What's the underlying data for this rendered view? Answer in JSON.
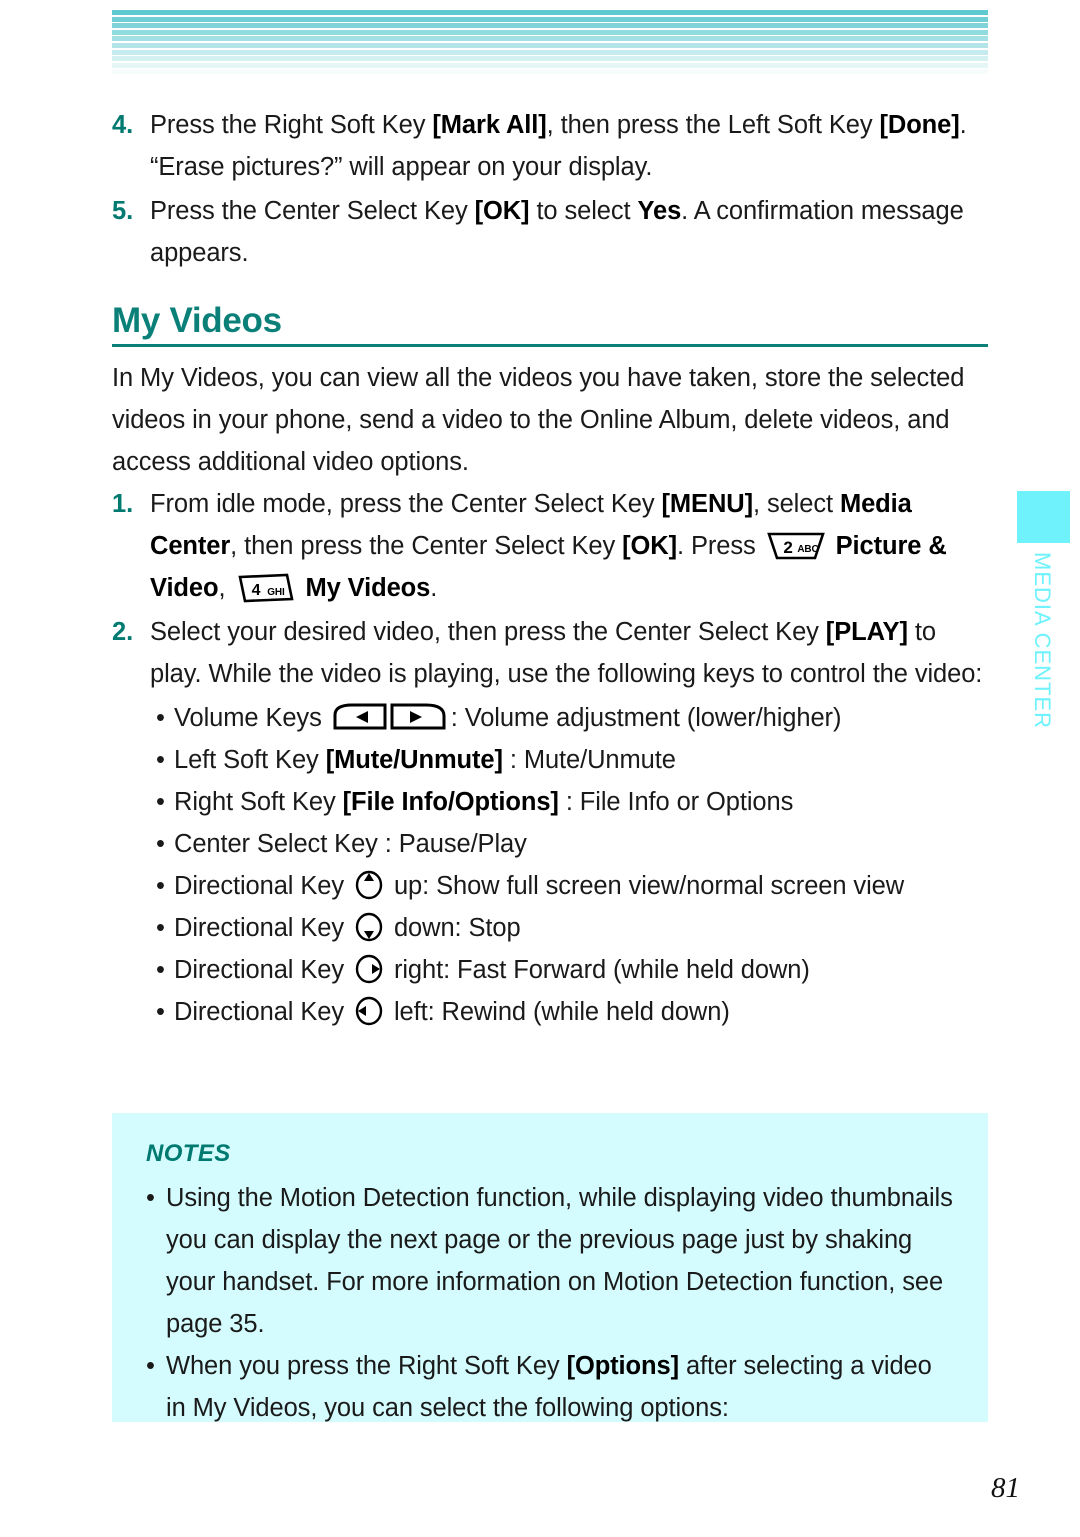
{
  "header": {
    "stripe_color_top": "#5ec9cf",
    "stripe_count": 11
  },
  "side_tab": {
    "label": "MEDIA CENTER",
    "color": "#6ff2fb"
  },
  "page_number": "81",
  "accent_color": "#007a70",
  "notes_bg": "#d4fbfd",
  "steps_top": [
    {
      "num": "4.",
      "parts": [
        {
          "t": "Press the Right Soft Key ",
          "b": false
        },
        {
          "t": "[Mark All]",
          "b": true
        },
        {
          "t": ", then press the Left Soft Key ",
          "b": false
        },
        {
          "t": "[Done]",
          "b": true
        },
        {
          "t": ". “Erase pictures?” will appear on your display.",
          "b": false
        }
      ]
    },
    {
      "num": "5.",
      "parts": [
        {
          "t": "Press the Center Select Key ",
          "b": false
        },
        {
          "t": "[OK]",
          "b": true
        },
        {
          "t": " to select ",
          "b": false
        },
        {
          "t": "Yes",
          "b": true
        },
        {
          "t": ". A confirmation message appears.",
          "b": false
        }
      ]
    }
  ],
  "section": {
    "title": "My Videos",
    "intro": "In My Videos, you can view all the videos you have taken, store the selected videos in your phone, send a video to the Online Album, delete videos, and access additional video options."
  },
  "steps_main": [
    {
      "num": "1.",
      "parts": [
        {
          "t": "From idle mode, press the Center Select Key ",
          "b": false
        },
        {
          "t": "[MENU]",
          "b": true
        },
        {
          "t": ", select ",
          "b": false
        },
        {
          "t": "Media Center",
          "b": true
        },
        {
          "t": ", then press the Center Select Key ",
          "b": false
        },
        {
          "t": "[OK]",
          "b": true
        },
        {
          "t": ". Press ",
          "b": false
        },
        {
          "icon": "key-2-abc"
        },
        {
          "t": " ",
          "b": false
        },
        {
          "t": "Picture & Video",
          "b": true
        },
        {
          "t": ", ",
          "b": false
        },
        {
          "icon": "key-4-ghi"
        },
        {
          "t": " ",
          "b": false
        },
        {
          "t": "My Videos",
          "b": true
        },
        {
          "t": ".",
          "b": false
        }
      ]
    },
    {
      "num": "2.",
      "parts": [
        {
          "t": "Select your desired video, then press the Center Select Key ",
          "b": false
        },
        {
          "t": "[PLAY]",
          "b": true
        },
        {
          "t": " to play. While the video is playing, use the following keys to control the video:",
          "b": false
        }
      ]
    }
  ],
  "key_icons": {
    "key_2": {
      "digit": "2",
      "letters": "ABC"
    },
    "key_4": {
      "digit": "4",
      "letters": "GHI"
    }
  },
  "bullets": [
    {
      "parts": [
        {
          "t": "Volume Keys ",
          "b": false
        },
        {
          "icon": "volume-keys"
        },
        {
          "t": ": Volume adjustment (lower/higher)",
          "b": false
        }
      ]
    },
    {
      "parts": [
        {
          "t": "Left Soft Key ",
          "b": false
        },
        {
          "t": "[Mute/Unmute]",
          "b": true
        },
        {
          "t": " : Mute/Unmute",
          "b": false
        }
      ]
    },
    {
      "parts": [
        {
          "t": "Right Soft Key ",
          "b": false
        },
        {
          "t": "[File Info/Options]",
          "b": true
        },
        {
          "t": " : File Info or Options",
          "b": false
        }
      ]
    },
    {
      "parts": [
        {
          "t": "Center Select Key : Pause/Play",
          "b": false
        }
      ]
    },
    {
      "parts": [
        {
          "t": "Directional Key ",
          "b": false
        },
        {
          "icon": "dpad-up"
        },
        {
          "t": " up: Show full screen view/normal screen view",
          "b": false
        }
      ]
    },
    {
      "parts": [
        {
          "t": "Directional Key ",
          "b": false
        },
        {
          "icon": "dpad-down"
        },
        {
          "t": " down: Stop",
          "b": false
        }
      ]
    },
    {
      "parts": [
        {
          "t": "Directional Key ",
          "b": false
        },
        {
          "icon": "dpad-right"
        },
        {
          "t": " right: Fast Forward (while held down)",
          "b": false
        }
      ]
    },
    {
      "parts": [
        {
          "t": "Directional Key ",
          "b": false
        },
        {
          "icon": "dpad-left"
        },
        {
          "t": " left: Rewind (while held down)",
          "b": false
        }
      ]
    }
  ],
  "notes": {
    "title": "NOTES",
    "items": [
      {
        "parts": [
          {
            "t": "Using the Motion Detection function, while displaying video thumbnails you can display the next page or the previous page just by shaking your handset. For more information on Motion Detection function, see page 35.",
            "b": false
          }
        ]
      },
      {
        "parts": [
          {
            "t": "When you press the Right Soft Key ",
            "b": false
          },
          {
            "t": "[Options]",
            "b": true
          },
          {
            "t": " after selecting a video in My Videos, you can select the following options:",
            "b": false
          }
        ]
      }
    ]
  }
}
